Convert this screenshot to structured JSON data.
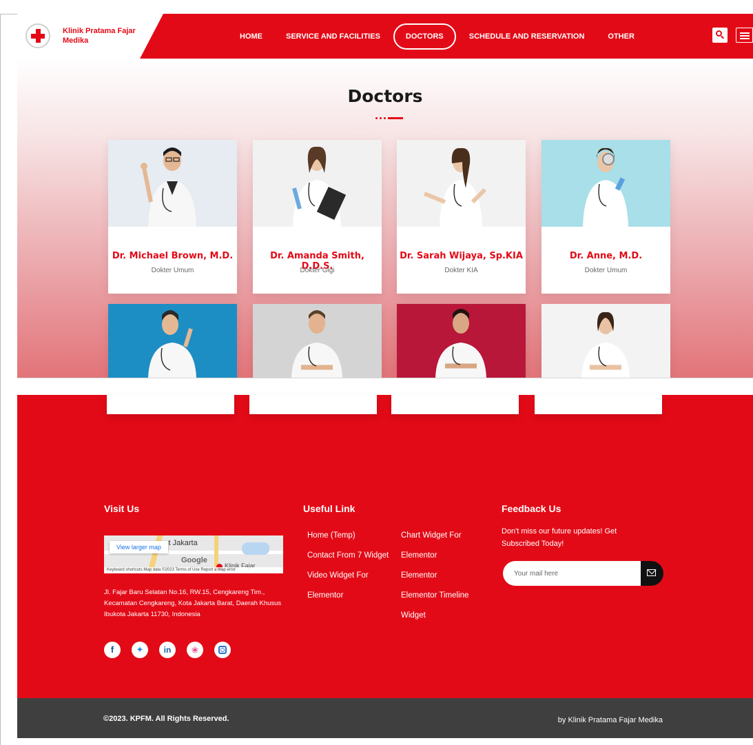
{
  "header": {
    "brand_name": "Klinik Pratama Fajar Medika",
    "nav": [
      "HOME",
      "SERVICE AND FACILITIES",
      "DOCTORS",
      "SCHEDULE AND RESERVATION",
      "OTHER"
    ],
    "active_nav": "DOCTORS"
  },
  "doctors_section": {
    "title": "Doctors",
    "cards": [
      {
        "name": "Dr. Michael Brown, M.D.",
        "role": "Dokter Umum"
      },
      {
        "name": "Dr. Amanda Smith, D.D.S.",
        "role": "Dokter Gigi"
      },
      {
        "name": "Dr. Sarah Wijaya, Sp.KIA",
        "role": "Dokter KIA"
      },
      {
        "name": "Dr. Anne, M.D.",
        "role": "Dokter Umum"
      }
    ]
  },
  "footer": {
    "visit_us": {
      "heading": "Visit Us",
      "map_button": "View larger map",
      "map_city": "st Jakarta",
      "map_brand": "Google",
      "map_place": "Klinik Fajar",
      "map_attribution": "Keyboard shortcuts   Map data ©2023   Terms of Use   Report a map error",
      "address": "Jl. Fajar Baru Selatan No.16, RW.15, Cengkareng Tim., Kecamatan Cengkareng, Kota Jakarta Barat, Daerah Khusus Ibukota Jakarta 11730, Indonesia"
    },
    "useful_link": {
      "heading": "Useful Link",
      "col1": [
        "Home (Temp)",
        "Contact From 7 Widget",
        "Video Widget For",
        "Elementor"
      ],
      "col2": [
        "Chart Widget For",
        "Elementor",
        "Elementor",
        "Elementor Timeline",
        "Widget"
      ]
    },
    "feedback": {
      "heading": "Feedback Us",
      "text": "Don't miss our future updates! Get Subscribed Today!",
      "placeholder": "Your mail here"
    },
    "social_icons": [
      "facebook-icon",
      "twitter-icon",
      "linkedin-icon",
      "dribbble-icon",
      "instagram-icon"
    ]
  },
  "bottom_bar": {
    "copyright": "©2023. KPFM. All Rights Reserved.",
    "byline": "by Klinik Pratama Fajar Medika"
  },
  "colors": {
    "brand_red": "#e30a17",
    "bottom_bar": "#3f3f3f"
  }
}
